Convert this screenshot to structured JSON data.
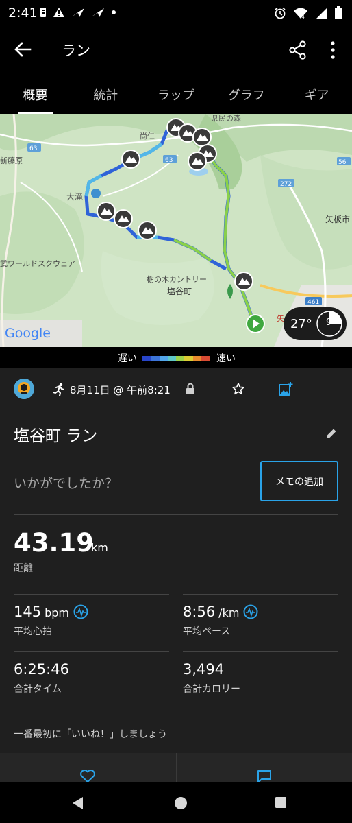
{
  "status_bar": {
    "time": "2:41",
    "left_icons": [
      "sim-icon",
      "alert-icon",
      "nav-arrow-icon",
      "nav-arrow-icon",
      "dot-icon"
    ],
    "right_icons": [
      "alarm-icon",
      "wifi-icon",
      "signal-icon",
      "battery-icon"
    ]
  },
  "app_bar": {
    "title": "ラン",
    "back_icon": "arrow-back-icon",
    "share_icon": "share-icon",
    "more_icon": "more-vert-icon"
  },
  "tabs": [
    {
      "label": "概要",
      "active": true
    },
    {
      "label": "統計",
      "active": false
    },
    {
      "label": "ラップ",
      "active": false
    },
    {
      "label": "グラフ",
      "active": false
    },
    {
      "label": "ギア",
      "active": false
    }
  ],
  "map": {
    "labels": {
      "place1": "尚仁",
      "place2": "県民の森",
      "place3": "大滝",
      "place4": "武ワールドスクウェア",
      "place5": "栃の木カントリー",
      "place6": "塩谷町",
      "place7": "矢板市",
      "place8": "新藤原",
      "place9": "矢",
      "road1": "63",
      "road2": "63",
      "road3": "272",
      "road4": "56",
      "road5": "461",
      "google": "Google"
    },
    "weather": {
      "temp": "27°",
      "wind": "9"
    },
    "colors": {
      "route_slow": "#2f63d8",
      "route_mid": "#52b7e8",
      "route_fast": "#8ad04b"
    }
  },
  "pace_legend": {
    "slow_label": "遅い",
    "fast_label": "速い",
    "colors": [
      "#2845c9",
      "#3c74d8",
      "#52a6ea",
      "#5fc7c6",
      "#9bd24b",
      "#dbcc34",
      "#e98b2e",
      "#d94b33"
    ]
  },
  "activity": {
    "date": "8月11日 @ 午前8:21",
    "title": "塩谷町 ラン",
    "how_prompt": "いかがでしたか？",
    "memo_button": "メモの追加"
  },
  "stats": {
    "distance": {
      "value": "43.19",
      "unit": "km",
      "label": "距離"
    },
    "avg_hr": {
      "value": "145",
      "unit": "bpm",
      "label": "平均心拍"
    },
    "avg_pace": {
      "value": "8:56",
      "unit": "/km",
      "label": "平均ペース"
    },
    "total_time": {
      "value": "6:25:46",
      "label": "合計タイム"
    },
    "total_calories": {
      "value": "3,494",
      "label": "合計カロリー"
    }
  },
  "social": {
    "like_prompt": "一番最初に「いいね！」しましょう"
  },
  "accent_color": "#2aa3e8"
}
